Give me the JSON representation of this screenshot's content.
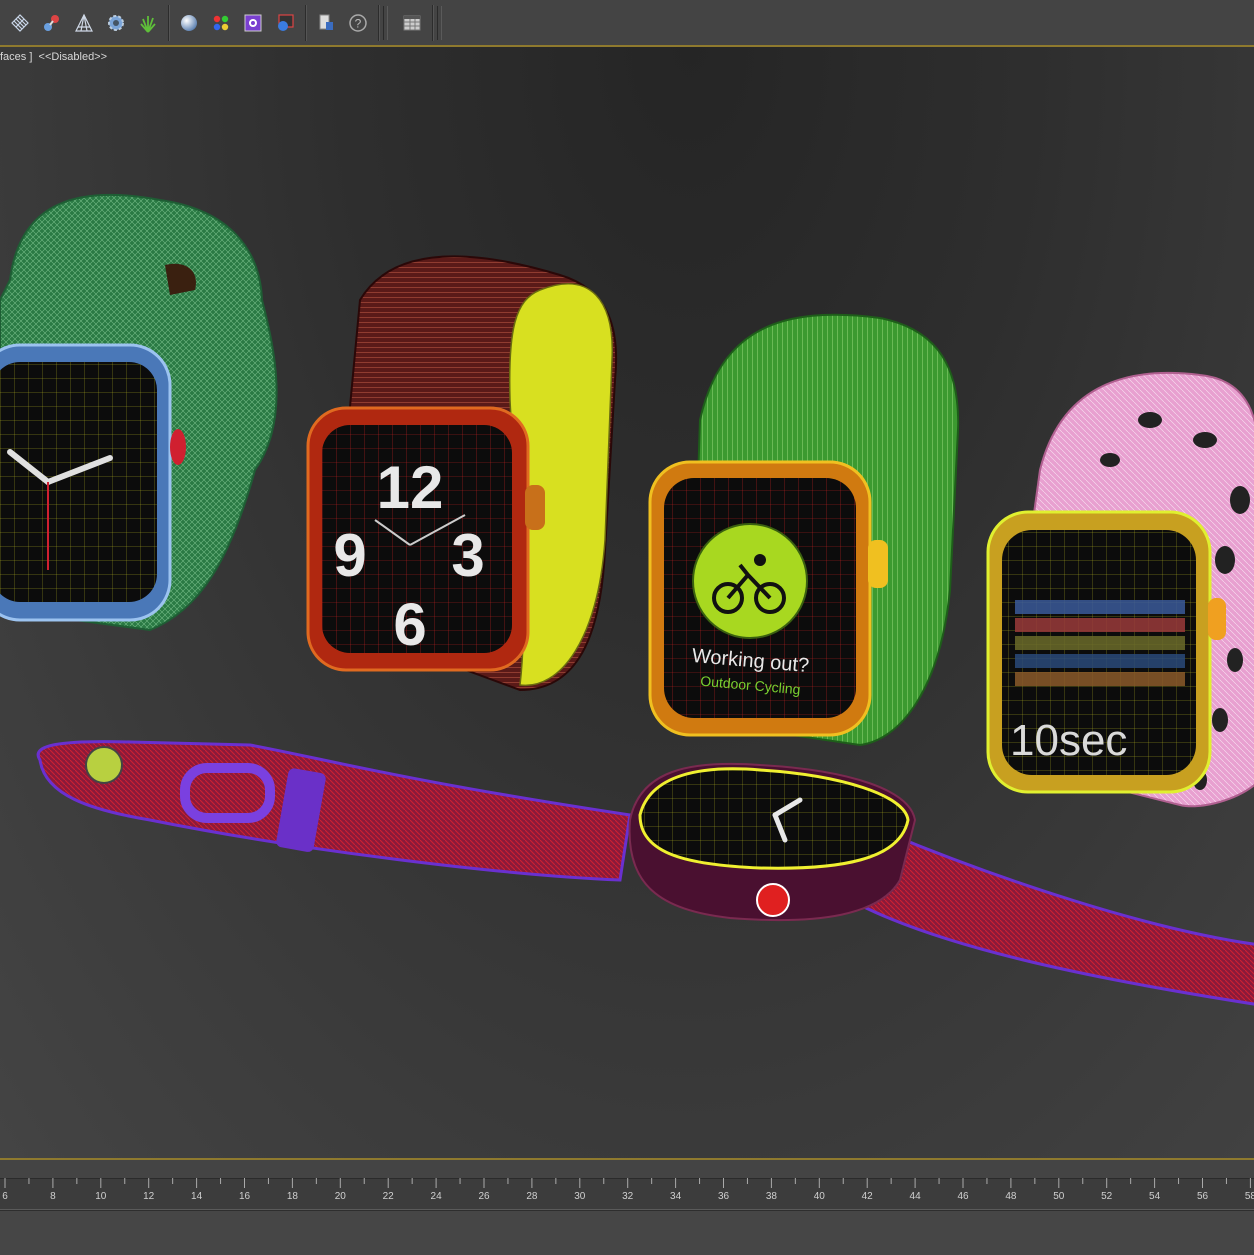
{
  "toolbar": {
    "groups": [
      [
        "snap-grid-icon",
        "bones-icon",
        "fan-icon",
        "gear-cog-icon",
        "grass-icon"
      ],
      [
        "sphere-icon",
        "color-dots-icon",
        "material-editor-icon",
        "render-frame-icon"
      ],
      [
        "render-setup-icon",
        "help-icon"
      ],
      [
        "table-grid-icon"
      ]
    ]
  },
  "viewport": {
    "label_prefix": "faces ]",
    "label_status": "<<Disabled>>"
  },
  "scene": {
    "watch_2_digits": [
      "12",
      "6",
      "9",
      "3"
    ],
    "watch_3_title": "Working out?",
    "watch_3_subtitle": "Outdoor Cycling",
    "watch_4_timer": "10sec",
    "colors": {
      "watch_1": "#2d8a4a",
      "watch_2": "#7a2a1a",
      "watch_3": "#3a9a32",
      "watch_4": "#e89acb",
      "watch_5": "#7a32c8",
      "accent": "#8f7a2e"
    }
  },
  "timeline": {
    "ticks": [
      "6",
      "8",
      "10",
      "12",
      "14",
      "16",
      "18",
      "20",
      "22",
      "24",
      "26",
      "28",
      "30",
      "32",
      "34",
      "36",
      "38",
      "40",
      "42",
      "44",
      "46",
      "48",
      "50",
      "52",
      "54",
      "56",
      "58"
    ]
  }
}
